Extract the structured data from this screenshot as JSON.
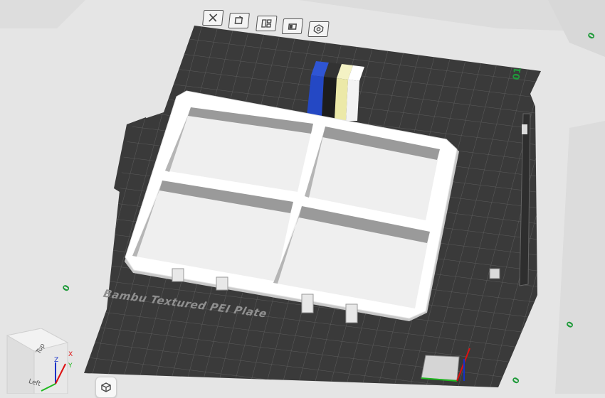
{
  "plate": {
    "label": "Bambu Textured PEI Plate",
    "plate_number": "01"
  },
  "toolbar": {
    "buttons": [
      {
        "name": "delete-plate",
        "icon": "close-icon"
      },
      {
        "name": "orient-plate",
        "icon": "orient-icon"
      },
      {
        "name": "arrange-plate",
        "icon": "arrange-icon"
      },
      {
        "name": "lock-plate",
        "icon": "lock-icon"
      },
      {
        "name": "plate-settings",
        "icon": "gear-icon"
      }
    ]
  },
  "view_cube": {
    "top": "Top",
    "left": "Left",
    "axis_x": "X",
    "axis_y": "Y",
    "axis_z": "Z"
  },
  "colors": {
    "bed": "#3a3a3a",
    "grid": "#5b5b5b",
    "model": "#ffffff",
    "filament_1": "#2f55d4",
    "filament_2": "#2b2b2b",
    "filament_3": "#f1efb0",
    "filament_4": "#ffffff",
    "accent_green": "#1f9a3a"
  }
}
